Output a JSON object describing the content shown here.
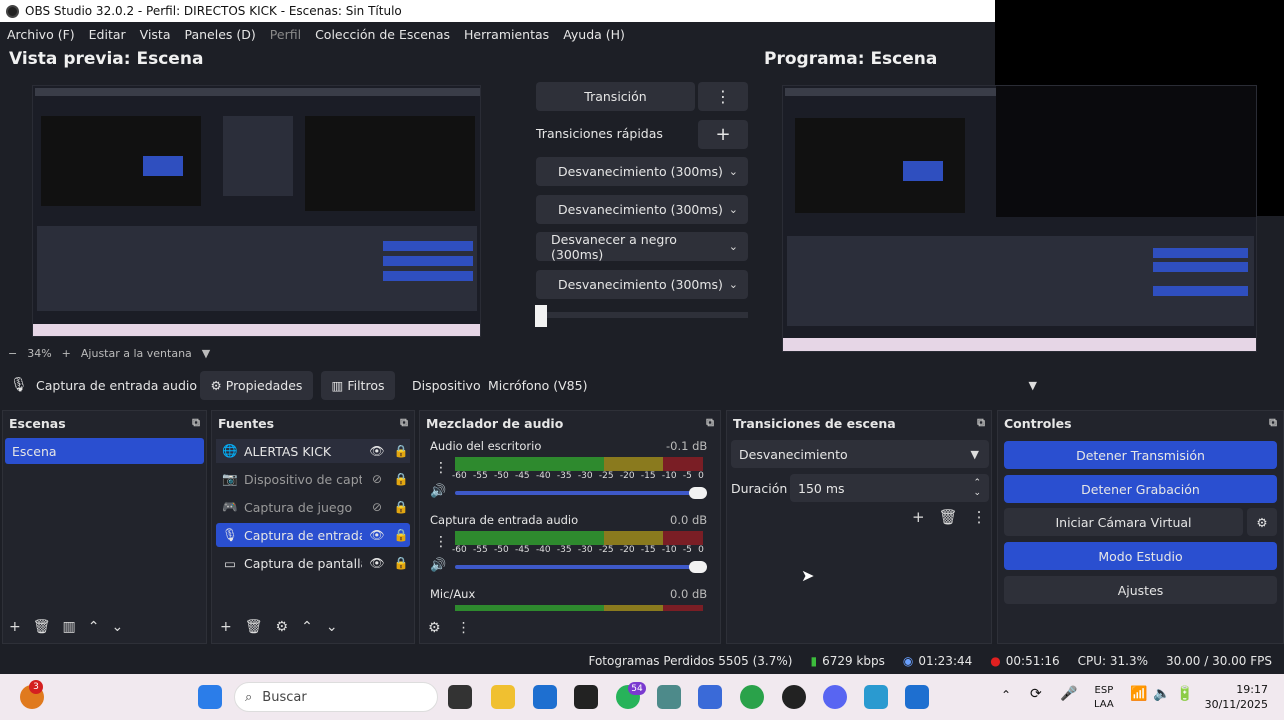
{
  "window": {
    "title": "OBS Studio 32.0.2 - Perfil: DIRECTOS KICK - Escenas: Sin Título"
  },
  "menu": [
    "Archivo (F)",
    "Editar",
    "Vista",
    "Paneles (D)",
    "Perfil",
    "Colección de Escenas",
    "Herramientas",
    "Ayuda (H)"
  ],
  "preview": {
    "title": "Vista previa: Escena",
    "zoom": "34%",
    "fit": "Ajustar a la ventana"
  },
  "program": {
    "title": "Programa: Escena"
  },
  "transition_panel": {
    "transition_btn": "Transición",
    "quick_label": "Transiciones rápidas",
    "quick": [
      "Desvanecimiento (300ms)",
      "Desvanecimiento (300ms)",
      "Desvanecer a negro (300ms)",
      "Desvanecimiento (300ms)"
    ]
  },
  "sourcebar": {
    "source": "Captura de entrada audio",
    "properties": "Propiedades",
    "filters": "Filtros",
    "device_label": "Dispositivo",
    "device_value": "Micrófono (V85)"
  },
  "scenes": {
    "title": "Escenas",
    "items": [
      "Escena"
    ]
  },
  "sources": {
    "title": "Fuentes",
    "items": [
      {
        "label": "ALERTAS KICK",
        "icon": "globe-icon"
      },
      {
        "label": "Dispositivo de captur",
        "icon": "camera-icon"
      },
      {
        "label": "Captura de juego",
        "icon": "gamepad-icon"
      },
      {
        "label": "Captura de entrada a",
        "icon": "microphone-icon"
      },
      {
        "label": "Captura de pantalla",
        "icon": "monitor-icon"
      }
    ]
  },
  "mixer": {
    "title": "Mezclador de audio",
    "channels": [
      {
        "name": "Audio del escritorio",
        "db": "-0.1 dB"
      },
      {
        "name": "Captura de entrada audio",
        "db": "0.0 dB"
      },
      {
        "name": "Mic/Aux",
        "db": "0.0 dB"
      }
    ],
    "ticks": [
      "-60",
      "-55",
      "-50",
      "-45",
      "-40",
      "-35",
      "-30",
      "-25",
      "-20",
      "-15",
      "-10",
      "-5",
      "0"
    ]
  },
  "scene_transitions": {
    "title": "Transiciones de escena",
    "selected": "Desvanecimiento",
    "duration_label": "Duración",
    "duration": "150 ms"
  },
  "controls": {
    "title": "Controles",
    "stop_stream": "Detener Transmisión",
    "stop_record": "Detener Grabación",
    "virtual_cam": "Iniciar Cámara Virtual",
    "studio": "Modo Estudio",
    "settings": "Ajustes"
  },
  "status": {
    "dropped": "Fotogramas Perdidos 5505 (3.7%)",
    "bitrate": "6729 kbps",
    "stream_time": "01:23:44",
    "rec_time": "00:51:16",
    "cpu": "CPU: 31.3%",
    "fps": "30.00 / 30.00 FPS"
  },
  "taskbar": {
    "search": "Buscar",
    "badge1": "3",
    "badge2": "54",
    "lang1": "ESP",
    "lang2": "LAA",
    "time": "19:17",
    "date": "30/11/2025"
  },
  "colors": {
    "accent": "#2a4fd0",
    "bg": "#1d1f26",
    "panel": "#22242c"
  }
}
